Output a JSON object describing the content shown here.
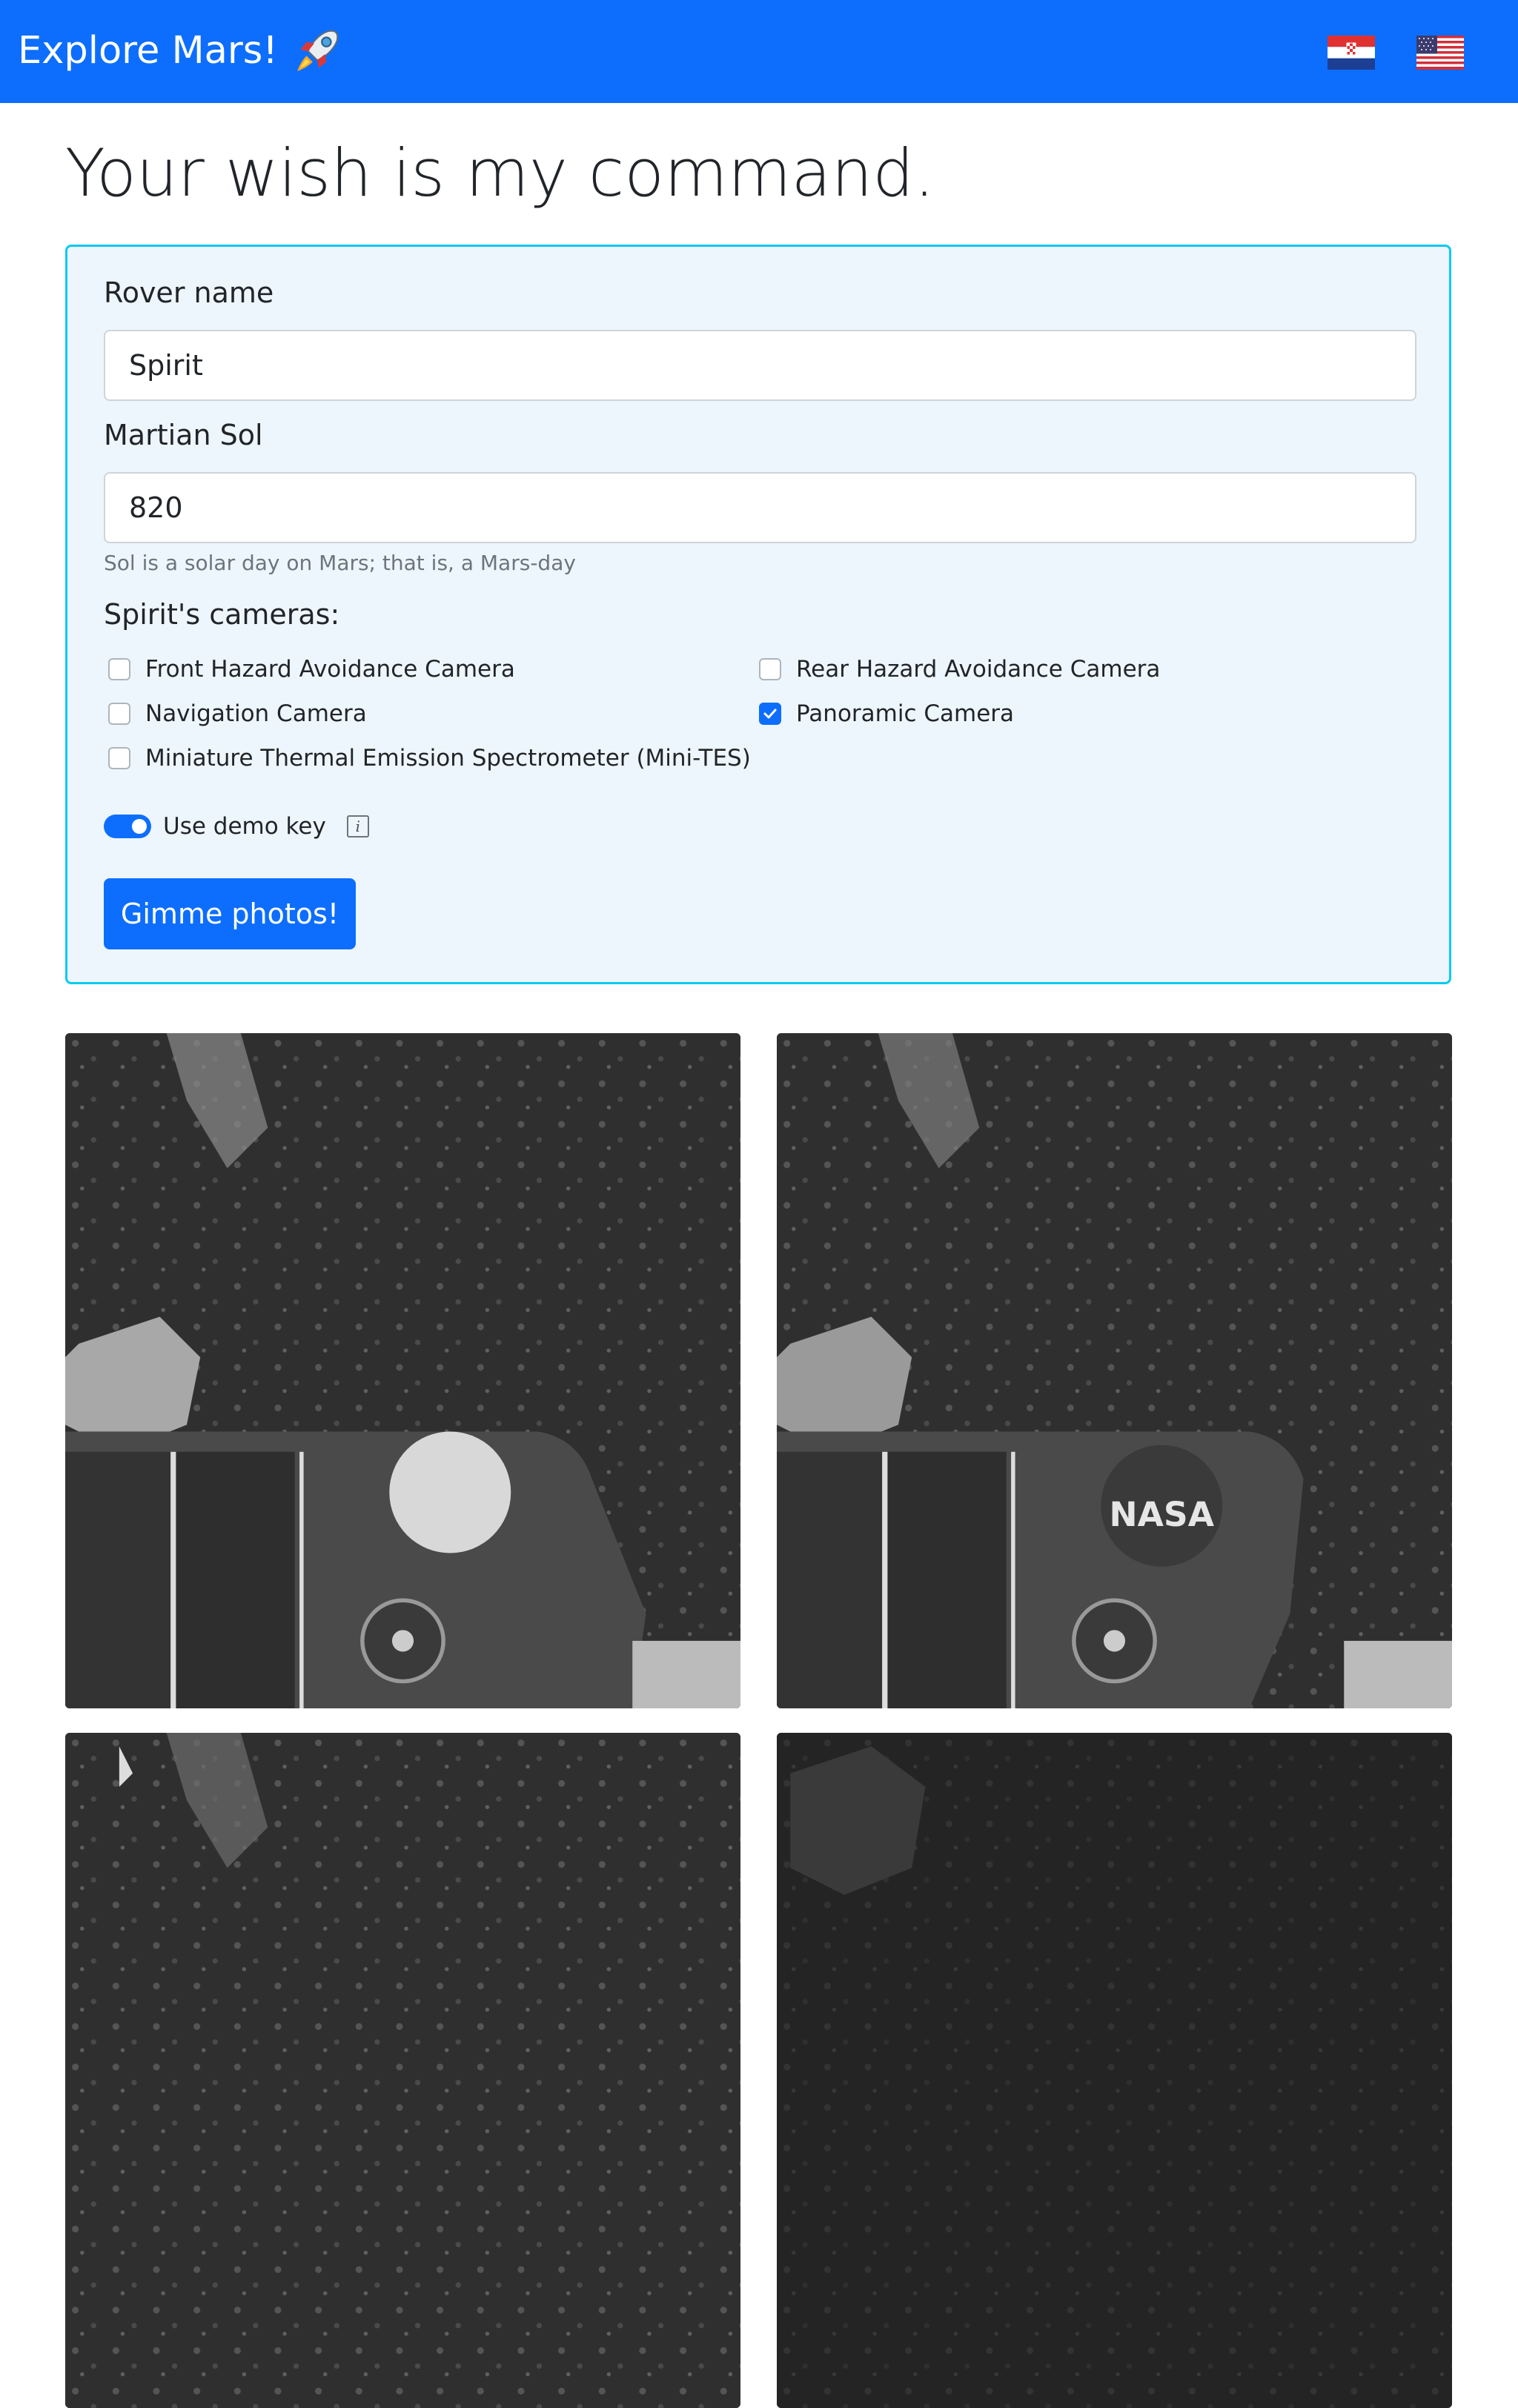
{
  "navbar": {
    "brand": "Explore Mars!",
    "brand_icon": "rocket-icon",
    "flags": [
      "croatia-flag",
      "usa-flag"
    ]
  },
  "page": {
    "heading": "Your wish is my command."
  },
  "form": {
    "rover_label": "Rover name",
    "rover_value": "Spirit",
    "sol_label": "Martian Sol",
    "sol_value": "820",
    "sol_hint": "Sol is a solar day on Mars; that is, a Mars-day",
    "cameras_label": "Spirit's cameras:",
    "cameras": [
      {
        "label": "Front Hazard Avoidance Camera",
        "checked": false
      },
      {
        "label": "Rear Hazard Avoidance Camera",
        "checked": false
      },
      {
        "label": "Navigation Camera",
        "checked": false
      },
      {
        "label": "Panoramic Camera",
        "checked": true
      },
      {
        "label": "Miniature Thermal Emission Spectrometer (Mini-TES)",
        "checked": false
      }
    ],
    "demo_key_label": "Use demo key",
    "demo_key_on": true,
    "info_icon": "i",
    "submit_label": "Gimme photos!"
  },
  "photos": {
    "items": [
      {
        "kind": "mars-surface-photo"
      },
      {
        "kind": "mars-surface-photo"
      },
      {
        "kind": "mars-surface-photo"
      },
      {
        "kind": "mars-surface-photo"
      }
    ]
  },
  "colors": {
    "primary": "#0d6efd",
    "panel_bg": "#eef6fd",
    "panel_border": "#0dcaf0"
  }
}
